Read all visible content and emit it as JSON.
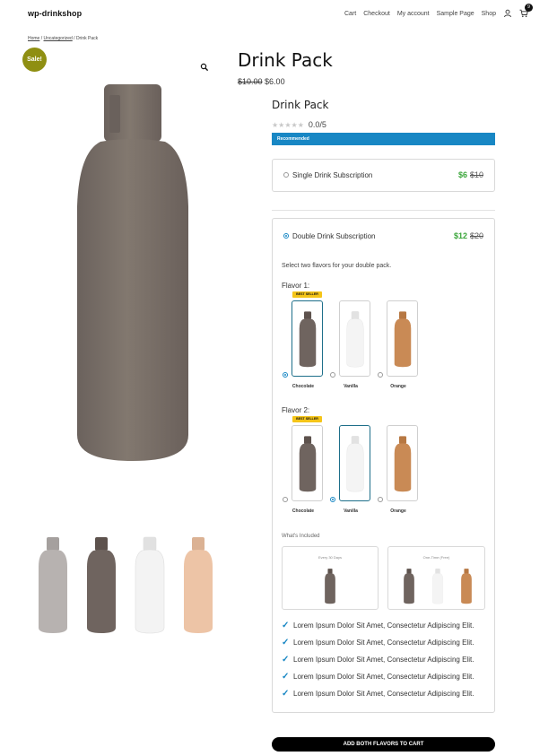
{
  "header": {
    "site_title": "wp-drinkshop",
    "nav": [
      "Cart",
      "Checkout",
      "My account",
      "Sample Page",
      "Shop"
    ],
    "cart_count": "9"
  },
  "breadcrumb": {
    "home": "Home",
    "category": "Uncategorized",
    "current": "Drink Pack",
    "sep": " / "
  },
  "gallery": {
    "sale_badge": "Sale!",
    "main_color": "#79706b",
    "thumbs": [
      {
        "name": "gray-bottle",
        "color": "#b7b2b0"
      },
      {
        "name": "brown-bottle",
        "color": "#6f645f"
      },
      {
        "name": "white-bottle",
        "color": "#f3f3f3"
      },
      {
        "name": "peach-bottle",
        "color": "#edc4a6"
      }
    ]
  },
  "product": {
    "title": "Drink Pack",
    "old_price": "$10.00",
    "price": "$6.00"
  },
  "plugin": {
    "title": "Drink Pack",
    "stars": "★★★★★",
    "rating_text": "0.0/5",
    "recommended": "Recommended",
    "single": {
      "label": "Single Drink Subscription",
      "price": "$6",
      "old_price": "$10"
    },
    "double": {
      "label": "Double Drink Subscription",
      "price": "$12",
      "old_price": "$20",
      "instructions": "Select two flavors for your double pack.",
      "flavor1_label": "Flavor 1:",
      "flavor2_label": "Flavor 2:",
      "best_seller": "BEST SELLER",
      "flavors": [
        {
          "name": "Chocolate",
          "color": "#6f645f"
        },
        {
          "name": "Vanilla",
          "color": "#f4f4f4"
        },
        {
          "name": "Orange",
          "color": "#c98a55"
        }
      ],
      "flavor1_selected": "Chocolate",
      "flavor2_selected": "Vanilla",
      "whats_included": "What's Included",
      "every_30": "Every 30 Days",
      "one_time": "One-Time (Free)",
      "bullets": [
        "Lorem Ipsum Dolor Sit Amet, Consectetur Adipiscing Elit.",
        "Lorem Ipsum Dolor Sit Amet, Consectetur Adipiscing Elit.",
        "Lorem Ipsum Dolor Sit Amet, Consectetur Adipiscing Elit.",
        "Lorem Ipsum Dolor Sit Amet, Consectetur Adipiscing Elit.",
        "Lorem Ipsum Dolor Sit Amet, Consectetur Adipiscing Elit."
      ]
    },
    "add_button": "ADD BOTH FLAVORS TO CART",
    "accent": "#1887c4",
    "price_green": "#3aa63a"
  }
}
